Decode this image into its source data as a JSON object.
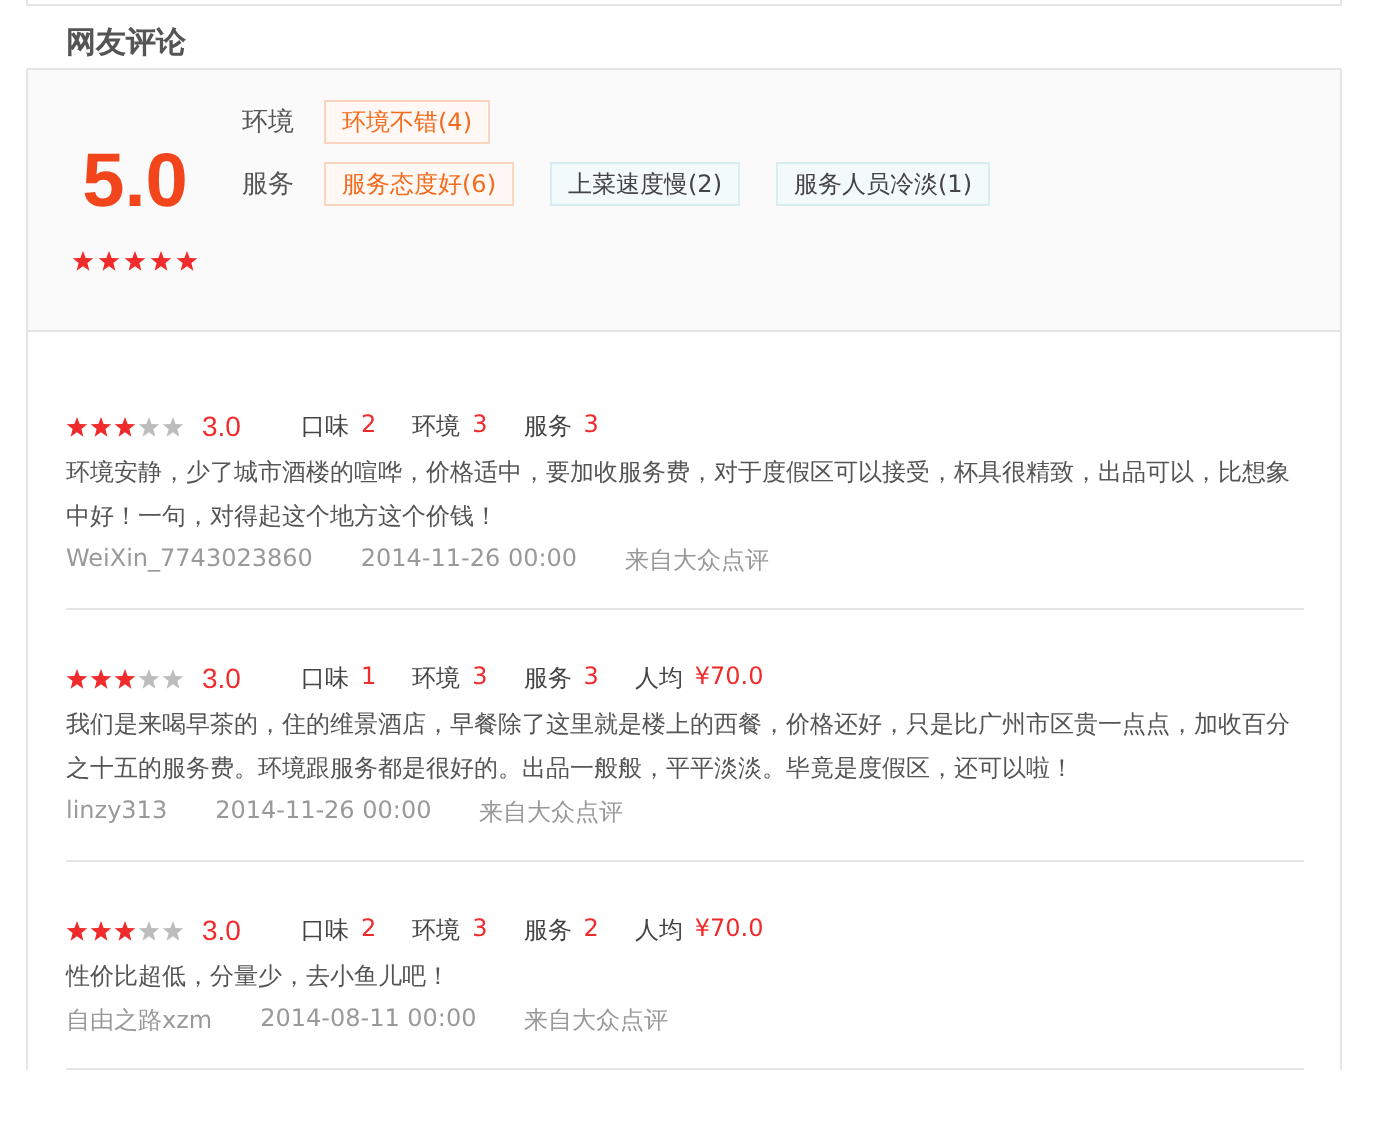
{
  "section_title": "网友评论",
  "summary": {
    "score": "5.0",
    "stars": 5,
    "tag_groups": [
      {
        "label": "环境",
        "tags": [
          {
            "text": "环境不错(4)",
            "kind": "positive"
          }
        ]
      },
      {
        "label": "服务",
        "tags": [
          {
            "text": "服务态度好(6)",
            "kind": "positive"
          },
          {
            "text": "上菜速度慢(2)",
            "kind": "negative"
          },
          {
            "text": "服务人员冷淡(1)",
            "kind": "negative"
          }
        ]
      }
    ]
  },
  "reviews": [
    {
      "stars": 3,
      "score": "3.0",
      "metrics": [
        {
          "label": "口味",
          "value": "2"
        },
        {
          "label": "环境",
          "value": "3"
        },
        {
          "label": "服务",
          "value": "3"
        }
      ],
      "text": "环境安静，少了城市酒楼的喧哗，价格适中，要加收服务费，对于度假区可以接受，杯具很精致，出品可以，比想象中好！一句，对得起这个地方这个价钱！",
      "user": "WeiXin_7743023860",
      "time": "2014-11-26 00:00",
      "source": "来自大众点评"
    },
    {
      "stars": 3,
      "score": "3.0",
      "metrics": [
        {
          "label": "口味",
          "value": "1"
        },
        {
          "label": "环境",
          "value": "3"
        },
        {
          "label": "服务",
          "value": "3"
        },
        {
          "label": "人均",
          "value": "¥70.0"
        }
      ],
      "text": "我们是来喝早茶的，住的维景酒店，早餐除了这里就是楼上的西餐，价格还好，只是比广州市区贵一点点，加收百分之十五的服务费。环境跟服务都是很好的。出品一般般，平平淡淡。毕竟是度假区，还可以啦！",
      "user": "linzy313",
      "time": "2014-11-26 00:00",
      "source": "来自大众点评"
    },
    {
      "stars": 3,
      "score": "3.0",
      "metrics": [
        {
          "label": "口味",
          "value": "2"
        },
        {
          "label": "环境",
          "value": "3"
        },
        {
          "label": "服务",
          "value": "2"
        },
        {
          "label": "人均",
          "value": "¥70.0"
        }
      ],
      "text": "性价比超低，分量少，去小鱼儿吧！",
      "user": "自由之路xzm",
      "time": "2014-08-11 00:00",
      "source": "来自大众点评"
    }
  ]
}
